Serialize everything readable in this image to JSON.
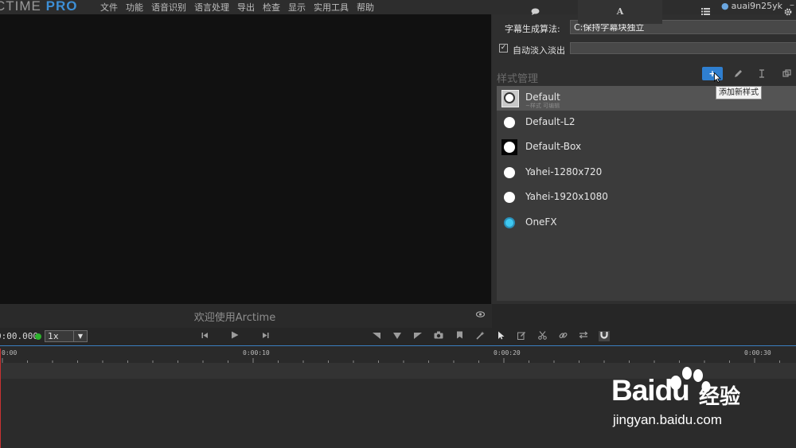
{
  "app": {
    "logo_main": "CTIME",
    "logo_pro": "PRO",
    "menus": [
      "文件",
      "功能",
      "语音识别",
      "语言处理",
      "导出",
      "检查",
      "显示",
      "实用工具",
      "帮助"
    ],
    "user": "auai9n25yk",
    "window_dash": "–"
  },
  "preview": {
    "welcome": "欢迎使用Arctime"
  },
  "settings": {
    "algo_label": "字幕生成算法:",
    "algo_value": "C:保持字幕块独立",
    "fade_checked": "✓",
    "fade_label": "自动淡入淡出"
  },
  "style_manager": {
    "title": "样式管理",
    "add_label": "+",
    "tooltip": "添加新样式",
    "items": [
      {
        "name": "Default",
        "sub": "~样式 可编辑"
      },
      {
        "name": "Default-L2"
      },
      {
        "name": "Default-Box"
      },
      {
        "name": "Yahei-1280x720"
      },
      {
        "name": "Yahei-1920x1080"
      },
      {
        "name": "OneFX"
      }
    ]
  },
  "panel_tabs": {
    "style_tab": "A"
  },
  "toolbar": {
    "timecode": "0:00.000",
    "speed": "1x"
  },
  "ruler": {
    "labels": [
      "0:00",
      "0:00:10",
      "0:00:20",
      "0:00:30"
    ]
  },
  "watermark": {
    "baidu": "Bai",
    "du": "du",
    "jingyan": "经验",
    "url": "jingyan.baidu.com"
  },
  "colors": {
    "accent": "#2f7fd0",
    "status_green": "#2db52d",
    "onefx": "#3fc8f0",
    "playhead": "#c83232"
  }
}
